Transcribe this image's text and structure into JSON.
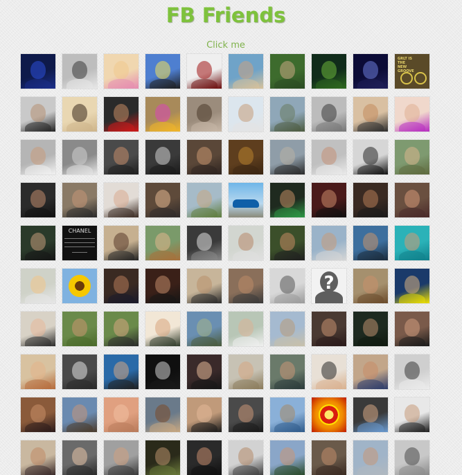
{
  "page": {
    "title": "FB Friends",
    "click_label": "Click me"
  },
  "friends": [
    {
      "kind": "photo",
      "bg": "#0e1a4a",
      "face": "#2b4fd8",
      "body": "#1b2e8a"
    },
    {
      "kind": "photo",
      "bg": "#bdbdbd",
      "face": "#3a3a3a",
      "body": "#e8e8e8"
    },
    {
      "kind": "photo",
      "bg": "#f0d7b0",
      "face": "#f1c98e",
      "body": "#e58ab0"
    },
    {
      "kind": "photo",
      "bg": "#4e7fd0",
      "face": "#f0e05a",
      "body": "#1e1e1e"
    },
    {
      "kind": "photo",
      "bg": "#efefef",
      "face": "#a01515",
      "body": "#6a0a0a"
    },
    {
      "kind": "photo",
      "bg": "#6fa3c8",
      "face": "#c9a383",
      "body": "#d9c29a"
    },
    {
      "kind": "photo",
      "bg": "#3d6b2d",
      "face": "#c9a783",
      "body": "#2a4a22"
    },
    {
      "kind": "photo",
      "bg": "#102b1a",
      "face": "#6bb43a",
      "body": "#2f6a1f"
    },
    {
      "kind": "photo",
      "bg": "#0b0b36",
      "face": "#6b7cd8",
      "body": "#1f1f5a"
    },
    {
      "kind": "bike",
      "text": "GRLT IS THE NEW GROOVE"
    },
    {
      "kind": "photo",
      "bg": "#c9c9c9",
      "face": "#b58f73",
      "body": "#222222"
    },
    {
      "kind": "photo",
      "bg": "#e9d7b2",
      "face": "#3b2a1e",
      "body": "#cdb48a"
    },
    {
      "kind": "photo",
      "bg": "#2a2a2a",
      "face": "#c48a62",
      "body": "#d01a1a"
    },
    {
      "kind": "photo",
      "bg": "#a88a5a",
      "face": "#d946b8",
      "body": "#f2b628"
    },
    {
      "kind": "photo",
      "bg": "#9b8c7c",
      "face": "#4a3a2a",
      "body": "#c8b8a8"
    },
    {
      "kind": "photo",
      "bg": "#dce6ee",
      "face": "#c69c7a",
      "body": "#e4e4e4"
    },
    {
      "kind": "photo",
      "bg": "#8fa7b8",
      "face": "#6a7c62",
      "body": "#4b5a3e"
    },
    {
      "kind": "photo",
      "bg": "#bcbcbc",
      "face": "#3a3a3a",
      "body": "#767676"
    },
    {
      "kind": "photo",
      "bg": "#d9c0a2",
      "face": "#c38a5d",
      "body": "#2b2b2b"
    },
    {
      "kind": "photo",
      "bg": "#f0d8cc",
      "face": "#e0b093",
      "body": "#b62ac0"
    },
    {
      "kind": "photo",
      "bg": "#b5b5b5",
      "face": "#c79a7c",
      "body": "#f2f2f2"
    },
    {
      "kind": "photo",
      "bg": "#8a8a8a",
      "face": "#d0d0d0",
      "body": "#e6e6e6"
    },
    {
      "kind": "photo",
      "bg": "#4a4a4a",
      "face": "#c48d6a",
      "body": "#202020"
    },
    {
      "kind": "photo",
      "bg": "#3a3a3a",
      "face": "#cfcfcf",
      "body": "#1a1a1a"
    },
    {
      "kind": "photo",
      "bg": "#5a4738",
      "face": "#c9956f",
      "body": "#2e2420"
    },
    {
      "kind": "photo",
      "bg": "#5e3e1e",
      "face": "#b8822e",
      "body": "#3b2612"
    },
    {
      "kind": "photo",
      "bg": "#8f9da8",
      "face": "#b8b0a4",
      "body": "#2a2a2a"
    },
    {
      "kind": "photo",
      "bg": "#c0c0c0",
      "face": "#c29076",
      "body": "#eaeaea"
    },
    {
      "kind": "photo",
      "bg": "#d6d6d6",
      "face": "#2a2a2a",
      "body": "#111111"
    },
    {
      "kind": "photo",
      "bg": "#7e9a70",
      "face": "#d8b78e",
      "body": "#5e6a3e"
    },
    {
      "kind": "photo",
      "bg": "#2b2b2b",
      "face": "#c08a6c",
      "body": "#111111"
    },
    {
      "kind": "photo",
      "bg": "#8a7a66",
      "face": "#c59677",
      "body": "#2a2a2a"
    },
    {
      "kind": "photo",
      "bg": "#e2dcd6",
      "face": "#d9ac92",
      "body": "#3a2a22"
    },
    {
      "kind": "photo",
      "bg": "#5e4a3a",
      "face": "#e2b690",
      "body": "#2e2a2a"
    },
    {
      "kind": "photo",
      "bg": "#a6bbc8",
      "face": "#c7a783",
      "body": "#5e7c3a"
    },
    {
      "kind": "car"
    },
    {
      "kind": "photo",
      "bg": "#1f2a1f",
      "face": "#c08b62",
      "body": "#2e9a46"
    },
    {
      "kind": "photo",
      "bg": "#4a1a1a",
      "face": "#c88a6a",
      "body": "#101010"
    },
    {
      "kind": "photo",
      "bg": "#3a2a22",
      "face": "#b37a56",
      "body": "#1a1a1a"
    },
    {
      "kind": "photo",
      "bg": "#6a5040",
      "face": "#d49777",
      "body": "#4a2a2a"
    },
    {
      "kind": "photo",
      "bg": "#2a3a2a",
      "face": "#c29a7a",
      "body": "#151515"
    },
    {
      "kind": "textpost",
      "logo": "CHANEL"
    },
    {
      "kind": "photo",
      "bg": "#c6b090",
      "face": "#5a3a2a",
      "body": "#222222"
    },
    {
      "kind": "photo",
      "bg": "#7a9a6a",
      "face": "#e0b68c",
      "body": "#a86f3a"
    },
    {
      "kind": "photo",
      "bg": "#3a3a3a",
      "face": "#dedede",
      "body": "#8a8a8a"
    },
    {
      "kind": "photo",
      "bg": "#d2d6d0",
      "face": "#b6896a",
      "body": "#e0e0e0"
    },
    {
      "kind": "photo",
      "bg": "#3b4f2a",
      "face": "#c58a62",
      "body": "#1f1f1f"
    },
    {
      "kind": "photo",
      "bg": "#9ab3c9",
      "face": "#c69a7a",
      "body": "#d6d6d6"
    },
    {
      "kind": "photo",
      "bg": "#3d6f9e",
      "face": "#c8936c",
      "body": "#1a2a3a"
    },
    {
      "kind": "photo",
      "bg": "#2bb2b8",
      "face": "#d09a74",
      "body": "#0f7f8a"
    },
    {
      "kind": "photo",
      "bg": "#cfd2c8",
      "face": "#f0c58a",
      "body": "#e6e6e6"
    },
    {
      "kind": "flower",
      "bg": "#7fb2e0"
    },
    {
      "kind": "photo",
      "bg": "#3a2a22",
      "face": "#b57a5a",
      "body": "#1a1a2a"
    },
    {
      "kind": "photo",
      "bg": "#3a2018",
      "face": "#c08a6a",
      "body": "#151515"
    },
    {
      "kind": "photo",
      "bg": "#c7b59a",
      "face": "#b8906c",
      "body": "#2a2a2a"
    },
    {
      "kind": "photo",
      "bg": "#8a6f5a",
      "face": "#bc8a68",
      "body": "#3a3a3a"
    },
    {
      "kind": "photo",
      "bg": "#d8d8d8",
      "face": "#5a5a5a",
      "body": "#9a9a9a"
    },
    {
      "kind": "silhouette",
      "mark": "?"
    },
    {
      "kind": "photo",
      "bg": "#a5906e",
      "face": "#c9906c",
      "body": "#6a4a2a"
    },
    {
      "kind": "photo",
      "bg": "#1a3a6a",
      "face": "#d9b080",
      "body": "#f0e200"
    },
    {
      "kind": "photo",
      "bg": "#d8d2c6",
      "face": "#e8b89a",
      "body": "#2a2a2a"
    },
    {
      "kind": "photo",
      "bg": "#6a8a4a",
      "face": "#c9956f",
      "body": "#4a6a2a"
    },
    {
      "kind": "photo",
      "bg": "#6a8a4a",
      "face": "#d6a680",
      "body": "#2a2a2a"
    },
    {
      "kind": "photo",
      "bg": "#f2e7d6",
      "face": "#d9a57f",
      "body": "#2e3a2a"
    },
    {
      "kind": "photo",
      "bg": "#6a8fb2",
      "face": "#a4b48a",
      "body": "#4a5a3a"
    },
    {
      "kind": "photo",
      "bg": "#b8c6b6",
      "face": "#d9b295",
      "body": "#f0f0f0"
    },
    {
      "kind": "photo",
      "bg": "#a5bad0",
      "face": "#b89a7a",
      "body": "#c8c0aa"
    },
    {
      "kind": "photo",
      "bg": "#4a3a32",
      "face": "#c58f70",
      "body": "#2a1a1a"
    },
    {
      "kind": "photo",
      "bg": "#1e2a20",
      "face": "#bb8e6e",
      "body": "#101a10"
    },
    {
      "kind": "photo",
      "bg": "#7a5a4a",
      "face": "#cf9c7e",
      "body": "#1a1a1a"
    },
    {
      "kind": "photo",
      "bg": "#d8c2a0",
      "face": "#e4b48a",
      "body": "#b56a3a"
    },
    {
      "kind": "photo",
      "bg": "#4a4a4a",
      "face": "#e0e0e0",
      "body": "#2a2a2a"
    },
    {
      "kind": "photo",
      "bg": "#2a6aa8",
      "face": "#d4a683",
      "body": "#1f1f1f"
    },
    {
      "kind": "photo",
      "bg": "#0f0f0f",
      "face": "#d0d0d0",
      "body": "#1a1a1a"
    },
    {
      "kind": "photo",
      "bg": "#3a2a2a",
      "face": "#e2b696",
      "body": "#161616"
    },
    {
      "kind": "photo",
      "bg": "#c7c2b4",
      "face": "#d6a884",
      "body": "#8a7a5a"
    },
    {
      "kind": "photo",
      "bg": "#6a7a6a",
      "face": "#c69676",
      "body": "#2a3a3a"
    },
    {
      "kind": "photo",
      "bg": "#e8e0d6",
      "face": "#2a2a2a",
      "body": "#d9b08e"
    },
    {
      "kind": "photo",
      "bg": "#c2a68a",
      "face": "#c98c68",
      "body": "#2a3a6a"
    },
    {
      "kind": "photo",
      "bg": "#cfcfcf",
      "face": "#3a3a3a",
      "body": "#ececec"
    },
    {
      "kind": "photo",
      "bg": "#8a5a3a",
      "face": "#c98f68",
      "body": "#2a1a1a"
    },
    {
      "kind": "photo",
      "bg": "#6a8ab0",
      "face": "#c5967a",
      "body": "#4a3a2a"
    },
    {
      "kind": "photo",
      "bg": "#e0a080",
      "face": "#f0c0a0",
      "body": "#b87a5a"
    },
    {
      "kind": "photo",
      "bg": "#6a7a8a",
      "face": "#7a4a2a",
      "body": "#c8a882"
    },
    {
      "kind": "photo",
      "bg": "#c09a7a",
      "face": "#e2b898",
      "body": "#1a1a1a"
    },
    {
      "kind": "photo",
      "bg": "#4a4a4a",
      "face": "#c89676",
      "body": "#1a1a1a"
    },
    {
      "kind": "photo",
      "bg": "#8ab0d8",
      "face": "#a48a6a",
      "body": "#2e5a8a"
    },
    {
      "kind": "emblem"
    },
    {
      "kind": "photo",
      "bg": "#3a3a3a",
      "face": "#d4a684",
      "body": "#6a9ad0"
    },
    {
      "kind": "photo",
      "bg": "#e8e8e8",
      "face": "#c79a7a",
      "body": "#1a1a1a"
    },
    {
      "kind": "photo",
      "bg": "#c9b8a0",
      "face": "#c08a66",
      "body": "#3a2a2a"
    },
    {
      "kind": "photo",
      "bg": "#6a6a6a",
      "face": "#e6c2a6",
      "body": "#2a2a2a"
    },
    {
      "kind": "photo",
      "bg": "#a0a0a0",
      "face": "#cfa080",
      "body": "#3a3a3a"
    },
    {
      "kind": "photo",
      "bg": "#2a2a1a",
      "face": "#b8906c",
      "body": "#6a7a3a"
    },
    {
      "kind": "photo",
      "bg": "#2a2a2a",
      "face": "#c58a6c",
      "body": "#101010"
    },
    {
      "kind": "photo",
      "bg": "#d2d2d2",
      "face": "#b48a6a",
      "body": "#404040"
    },
    {
      "kind": "photo",
      "bg": "#8aa6c8",
      "face": "#c89676",
      "body": "#2a4a2a"
    },
    {
      "kind": "photo",
      "bg": "#6a5a4a",
      "face": "#bf8c6a",
      "body": "#3a2a22"
    },
    {
      "kind": "photo",
      "bg": "#a0b4c8",
      "face": "#c79878",
      "body": "#b0b8c0"
    },
    {
      "kind": "photo",
      "bg": "#c8c8c8",
      "face": "#4a4a4a",
      "body": "#8a8a8a"
    }
  ]
}
